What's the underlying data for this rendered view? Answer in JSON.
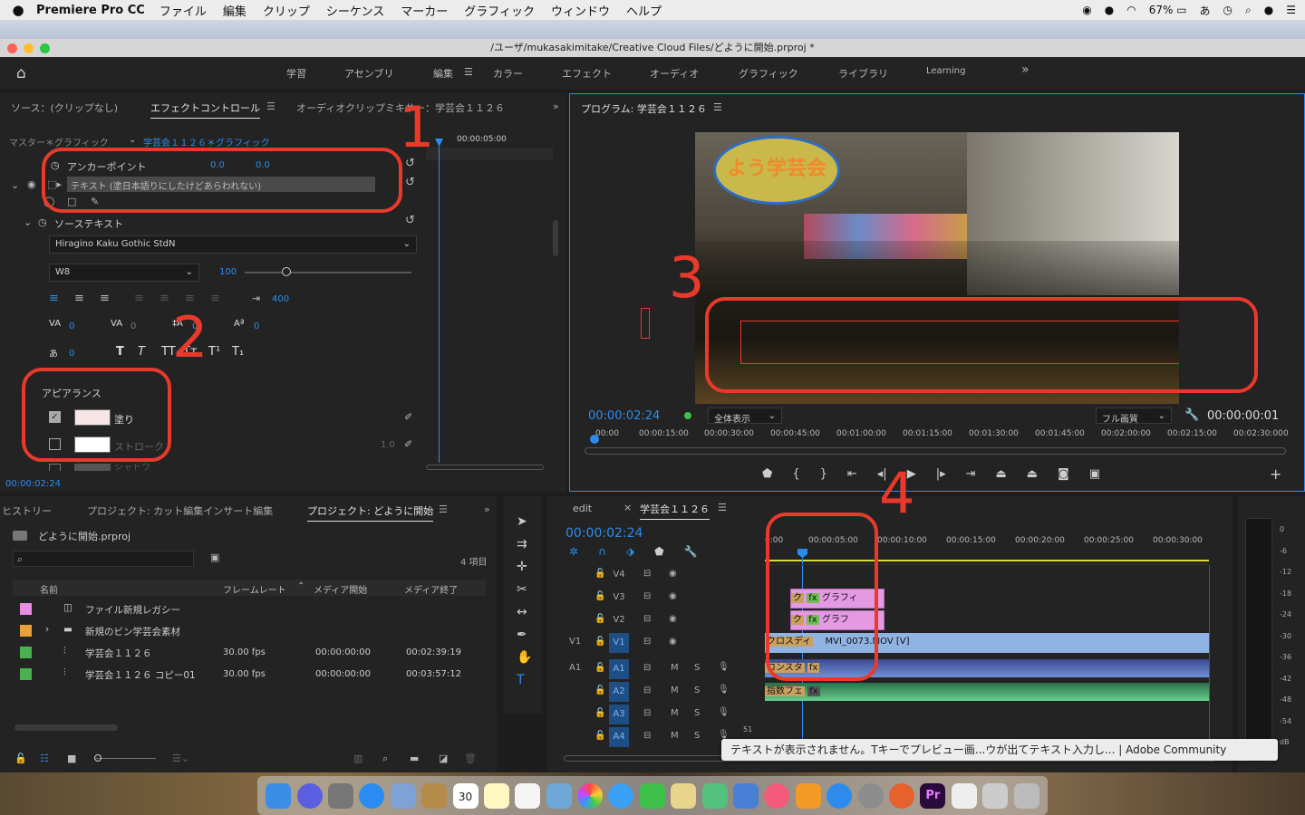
{
  "menubar": {
    "apple": "",
    "app_name": "Premiere Pro CC",
    "items": [
      "ファイル",
      "編集",
      "クリップ",
      "シーケンス",
      "マーカー",
      "グラフィック",
      "ウィンドウ",
      "ヘルプ"
    ],
    "battery": "67%",
    "input_method": "あ"
  },
  "window": {
    "title": "/ユーザ/mukasakimitake/Creative Cloud Files/どように開始.prproj *"
  },
  "workspaces": [
    "学習",
    "アセンブリ",
    "編集",
    "カラー",
    "エフェクト",
    "オーディオ",
    "グラフィック",
    "ライブラリ",
    "Learning"
  ],
  "workspace_more": "»",
  "source_panel": {
    "tabs": [
      "ソース：(クリップなし)",
      "エフェクトコントロール",
      "オーディオクリップミキサー：学芸会１１２６"
    ],
    "active_tab": "エフェクトコントロール",
    "breadcrumb_master": "マスター＊グラフィック",
    "breadcrumb_clip": "学芸会１１２６＊グラフィック",
    "mini_timecode": "00:00:05:00",
    "anchor_label": "アンカーポイント",
    "anchor_x": "0.0",
    "anchor_y": "0.0",
    "text_layer": "テキスト (塗日本語りにしたけどあらわれない)",
    "source_text_label": "ソーステキスト",
    "font_name": "Hiragino Kaku Gothic StdN",
    "font_weight": "W8",
    "font_size": "100",
    "tab_stop": "400",
    "kerning": "0",
    "tracking": "0",
    "leading": "0",
    "baseline": "0",
    "tsume": "0",
    "style_buttons": [
      "T",
      "T",
      "TT",
      "Tт",
      "T¹",
      "T₁"
    ],
    "appearance_label": "アピアランス",
    "fill_label": "塗り",
    "stroke_label": "ストローク",
    "stroke_value": "1.0",
    "shadow_label": "シャドウ",
    "fill_color": "#f8e6e6",
    "stroke_color": "#ffffff",
    "bottom_timecode": "00:00:02:24"
  },
  "program_monitor": {
    "title": "プログラム: 学芸会１１２６",
    "overlay_text": "よう学芸会",
    "timecode": "00:00:02:24",
    "zoom": "全体表示",
    "quality": "フル画質",
    "duration": "00:00:00:01",
    "ruler": [
      "00:00",
      "00:00:15:00",
      "00:00:30:00",
      "00:00:45:00",
      "00:01:00:00",
      "00:01:15:00",
      "00:01:30:00",
      "00:01:45:00",
      "00:02:00:00",
      "00:02:15:00",
      "00:02:30:00",
      "0"
    ]
  },
  "project_panel": {
    "tabs": [
      "ヒストリー",
      "プロジェクト: カット編集インサート編集",
      "プロジェクト: どように開始"
    ],
    "active_tab": "プロジェクト: どように開始",
    "project_file": "どように開始.prproj",
    "item_count": "4 項目",
    "columns": [
      "名前",
      "フレームレート",
      "メディア開始",
      "メディア終了"
    ],
    "rows": [
      {
        "color": "#e88ee0",
        "name": "ファイル新規レガシー",
        "fps": "",
        "start": "",
        "end": ""
      },
      {
        "color": "#e9a13b",
        "name": "新規のビン学芸会素材",
        "fps": "",
        "start": "",
        "end": ""
      },
      {
        "color": "#4cb050",
        "name": "学芸会１１２６",
        "fps": "30.00 fps",
        "start": "00:00:00:00",
        "end": "00:02:39:19"
      },
      {
        "color": "#4cb050",
        "name": "学芸会１１２６ コピー01",
        "fps": "30.00 fps",
        "start": "00:00:00:00",
        "end": "00:03:57:12"
      }
    ]
  },
  "timeline": {
    "tabs": [
      "edit",
      "学芸会１１２６"
    ],
    "active_tab": "学芸会１１２６",
    "timecode": "00:00:02:24",
    "ruler": [
      "0:00",
      "00:00:05:00",
      "00:00:10:00",
      "00:00:15:00",
      "00:00:20:00",
      "00:00:25:00",
      "00:00:30:00"
    ],
    "video_tracks": [
      "V4",
      "V3",
      "V2",
      "V1"
    ],
    "audio_tracks": [
      "A1",
      "A2",
      "A3",
      "A4"
    ],
    "source_v": "V1",
    "source_a": "A1",
    "mute_label": "M",
    "solo_label": "S",
    "vol_value": "51",
    "clip_graphic1": "グラフィ",
    "clip_graphic2": "グラフ",
    "clip_video_cross": "クロスディ",
    "clip_video_main": "MVI_0073.MOV [V]",
    "clip_audio_cross": "コンスタ",
    "clip_audio2": "指数フェ",
    "fx_badge": "fx",
    "meter_scale": [
      "0",
      "-6",
      "-12",
      "-18",
      "-24",
      "-30",
      "-36",
      "-42",
      "-48",
      "-54",
      "dB"
    ]
  },
  "tooltip": "テキストが表示されません。Tキーでプレビュー画...ウが出てテキスト入力し... | Adobe Community",
  "annotations": [
    "1",
    "2",
    "3",
    "4"
  ],
  "calendar_day": "30",
  "premiere_icon": "Pr",
  "colors": {
    "accent": "#2d8ceb",
    "annotation": "#e8392b",
    "graphic_clip": "#e39ae3",
    "video_clip": "#8fb3e3",
    "audio_clip": "#3d9b6b"
  }
}
